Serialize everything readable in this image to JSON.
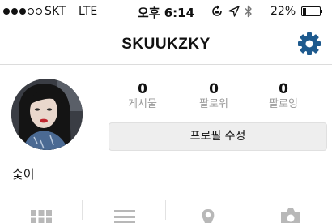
{
  "status_bar": {
    "carrier": "SKT",
    "network": "LTE",
    "time": "오후 6:14",
    "battery_percent_text": "22%",
    "battery_level": 0.22,
    "signal_bars": 3,
    "signal_total": 5
  },
  "nav": {
    "title": "SKUUKZKY",
    "settings_icon": "gear-icon"
  },
  "profile": {
    "stats": [
      {
        "value": "0",
        "label": "게시물"
      },
      {
        "value": "0",
        "label": "팔로워"
      },
      {
        "value": "0",
        "label": "팔로잉"
      }
    ],
    "edit_button_label": "프로필 수정",
    "name": "숮이"
  },
  "tabs": [
    {
      "icon": "grid-icon"
    },
    {
      "icon": "list-icon"
    },
    {
      "icon": "person-icon"
    },
    {
      "icon": "camera-icon"
    }
  ],
  "colors": {
    "accent": "#1e5a8e",
    "stat_label": "#9a9a9a",
    "button_bg": "#eeeeee",
    "divider": "#dcdcdc",
    "tab_icon": "#b8b8b8"
  }
}
